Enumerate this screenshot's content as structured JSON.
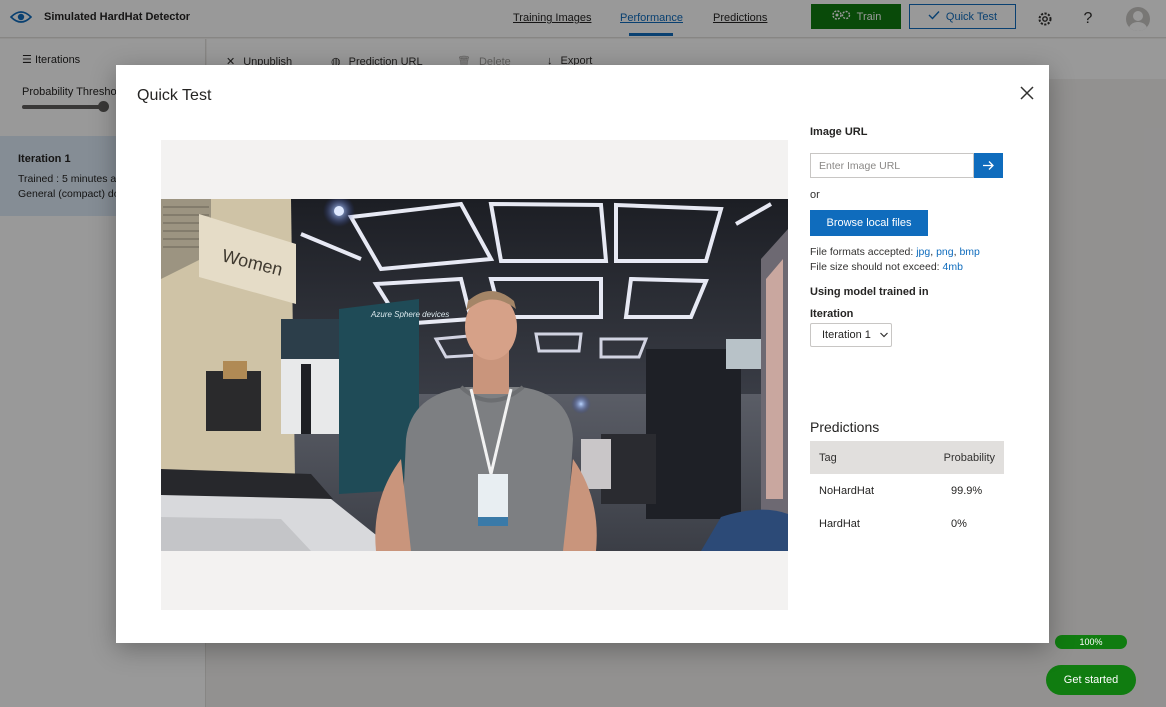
{
  "app": {
    "title": "Simulated HardHat Detector"
  },
  "nav": {
    "training_images": "Training Images",
    "performance": "Performance",
    "predictions": "Predictions"
  },
  "toolbar": {
    "train_label": "Train",
    "quick_test_label": "Quick Test"
  },
  "sidebar": {
    "iterations_label": "Iterations",
    "threshold_label": "Probability Threshold",
    "threshold_fraction": 0.93,
    "iteration_card": {
      "title": "Iteration 1",
      "trained_text": "Trained : 5 minutes a",
      "domain_text": "General (compact) do"
    }
  },
  "command_bar": {
    "unpublish": "Unpublish",
    "prediction_url": "Prediction URL",
    "delete": "Delete",
    "export": "Export"
  },
  "modal": {
    "title": "Quick Test",
    "image_url_label": "Image URL",
    "image_url_placeholder": "Enter Image URL",
    "or_text": "or",
    "browse_label": "Browse local files",
    "formats_prefix": "File formats accepted: ",
    "formats": [
      "jpg",
      "png",
      "bmp"
    ],
    "size_prefix": "File size should not exceed: ",
    "size_value": "4mb",
    "using_model_label": "Using model trained in",
    "iteration_label": "Iteration",
    "iteration_selected": "Iteration 1",
    "predictions_title": "Predictions",
    "table_headers": {
      "tag": "Tag",
      "probability": "Probability"
    },
    "predictions": [
      {
        "tag": "NoHardHat",
        "probability": "99.9%"
      },
      {
        "tag": "HardHat",
        "probability": "0%"
      }
    ]
  },
  "photo": {
    "sign_text": "Women",
    "booth_sign": "Azure Sphere devices"
  },
  "footer": {
    "progress_text": "100%",
    "get_started_label": "Get started"
  },
  "colors": {
    "accent": "#0f6cbd",
    "train_green": "#107c10",
    "overlay": "rgba(0,0,0,0.40)"
  }
}
